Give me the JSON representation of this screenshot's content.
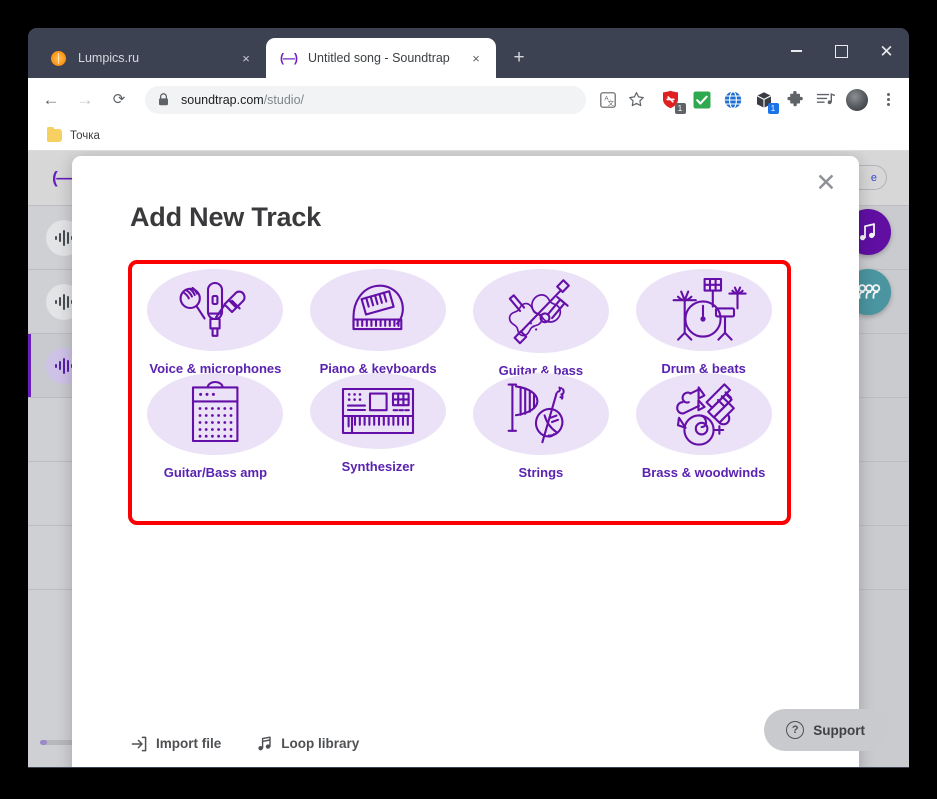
{
  "window": {
    "minimize_label": "Minimize",
    "maximize_label": "Maximize",
    "close_label": "Close"
  },
  "tabs": [
    {
      "title": "Lumpics.ru",
      "favicon": "orange-circle-icon",
      "active": false,
      "close_label": "×"
    },
    {
      "title": "Untitled song - Soundtrap",
      "favicon": "soundtrap-icon",
      "active": true,
      "close_label": "×"
    }
  ],
  "new_tab_label": "+",
  "toolbar": {
    "back_label": "←",
    "forward_label": "→",
    "reload_label": "⟳",
    "lock_icon": "lock-icon",
    "url_host": "soundtrap.com",
    "url_path": "/studio/",
    "translate_icon": "translate-icon",
    "bookmark_icon": "star-icon",
    "menu_icon": "three-dots-icon",
    "extensions": [
      {
        "name": "adblock-extension-icon",
        "badge": "1",
        "badge_style": "gray"
      },
      {
        "name": "checkmark-extension-icon",
        "badge": "",
        "badge_style": ""
      },
      {
        "name": "globe-extension-icon",
        "badge": "",
        "badge_style": ""
      },
      {
        "name": "box-extension-icon",
        "badge": "1",
        "badge_style": "blue"
      },
      {
        "name": "puzzle-extensions-icon",
        "badge": "",
        "badge_style": ""
      },
      {
        "name": "music-list-extension-icon",
        "badge": "",
        "badge_style": ""
      }
    ],
    "avatar_icon": "profile-avatar-icon"
  },
  "bookmarks": [
    {
      "label": "Точка",
      "icon": "folder-icon"
    }
  ],
  "app": {
    "logo_text": "(—)",
    "pill_text": "e",
    "tracks": [
      {
        "icon": "waveform-icon",
        "selected": false
      },
      {
        "icon": "waveform-icon",
        "selected": false
      },
      {
        "icon": "waveform-icon",
        "selected": true
      }
    ],
    "fab_loops_icon": "music-note-icon",
    "fab_collab_icon": "collaborate-icon",
    "zoom_out_icon": "zoom-out-icon"
  },
  "modal": {
    "title": "Add New Track",
    "close_label": "✕",
    "instruments": [
      {
        "label": "Voice & microphones",
        "icon": "microphone-icon"
      },
      {
        "label": "Piano & keyboards",
        "icon": "grand-piano-icon"
      },
      {
        "label": "Guitar & bass",
        "icon": "guitar-bass-icon"
      },
      {
        "label": "Drum & beats",
        "icon": "drum-kit-icon"
      },
      {
        "label": "Guitar/Bass amp",
        "icon": "amplifier-icon"
      },
      {
        "label": "Synthesizer",
        "icon": "synthesizer-icon"
      },
      {
        "label": "Strings",
        "icon": "harp-cello-icon"
      },
      {
        "label": "Brass & woodwinds",
        "icon": "brass-horn-icon"
      }
    ],
    "footer_links": [
      {
        "label": "Import file",
        "icon": "import-file-icon"
      },
      {
        "label": "Loop library",
        "icon": "loop-library-icon"
      }
    ],
    "highlight_color": "#fb0000"
  },
  "support": {
    "label": "Support",
    "icon": "question-mark-icon"
  },
  "colors": {
    "brand_purple": "#5a22b0",
    "tile_background": "#ece2f7",
    "browser_chrome": "#3c4251",
    "highlight_red": "#fb0000"
  }
}
